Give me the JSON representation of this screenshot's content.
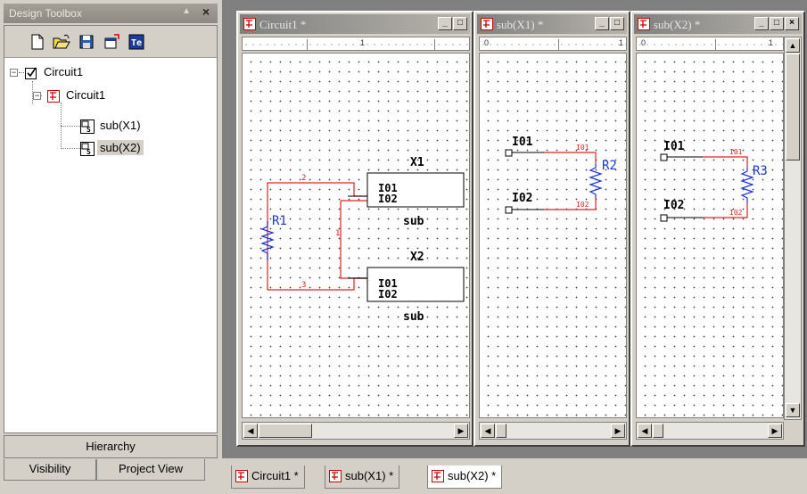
{
  "toolbox": {
    "title": "Design Toolbox",
    "pin_glyph": "▲",
    "close_glyph": "×",
    "toolbar": [
      "new-icon",
      "open-icon",
      "save-icon",
      "export-icon",
      "properties-icon"
    ],
    "tree": [
      {
        "label": "Circuit1",
        "icon": "project-check-icon",
        "level": 0
      },
      {
        "label": "Circuit1",
        "icon": "schematic-icon",
        "level": 1
      },
      {
        "label": "sub(X1)",
        "icon": "subcircuit-icon",
        "level": 2
      },
      {
        "label": "sub(X2)",
        "icon": "subcircuit-icon",
        "level": 2,
        "selected": true
      }
    ],
    "hierarchy_label": "Hierarchy",
    "tabs": [
      "Visibility",
      "Project View"
    ]
  },
  "windows": [
    {
      "title": "Circuit1 *",
      "ruler_label": "1"
    },
    {
      "title": "sub(X1) *",
      "ruler_label_left": "0",
      "ruler_label": "1"
    },
    {
      "title": "sub(X2) *",
      "ruler_label_left": "0",
      "ruler_label": "1"
    }
  ],
  "window_buttons": {
    "minimize": "_",
    "maximize": "□",
    "close": "×"
  },
  "schematic_main": {
    "x1_label": "X1",
    "x2_label": "X2",
    "pin1": "I01",
    "pin2": "I02",
    "block_name": "sub",
    "resistor": "R1",
    "net2": "2",
    "net1": "1",
    "net3": "3"
  },
  "schematic_x1": {
    "pin1": "I01",
    "pin2": "I02",
    "net1": "I01",
    "net2": "I02",
    "resistor": "R2"
  },
  "schematic_x2": {
    "pin1": "I01",
    "pin2": "I02",
    "net1": "I01",
    "net2": "I02",
    "resistor": "R3"
  },
  "doc_tabs": [
    "Circuit1 *",
    "sub(X1) *",
    "sub(X2) *"
  ],
  "colors": {
    "wire_red": "#e02020",
    "component_blue": "#1a35d6",
    "selection": "#d4d0c8"
  }
}
